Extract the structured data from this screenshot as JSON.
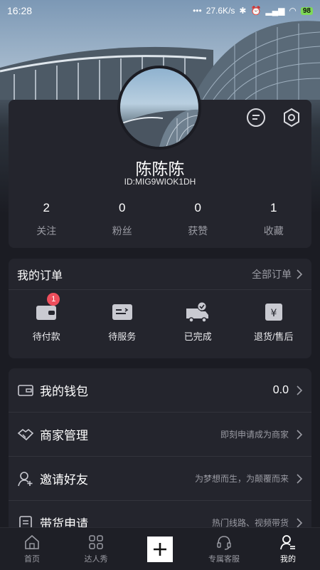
{
  "status_bar": {
    "time": "16:28",
    "network_speed": "27.6K/s",
    "battery": "98"
  },
  "profile": {
    "username": "陈陈陈",
    "user_id": "ID:MIG9WIOK1DH",
    "stats": [
      {
        "value": "2",
        "label": "关注"
      },
      {
        "value": "0",
        "label": "粉丝"
      },
      {
        "value": "0",
        "label": "获赞"
      },
      {
        "value": "1",
        "label": "收藏"
      }
    ]
  },
  "orders": {
    "title": "我的订单",
    "all_orders": "全部订单",
    "items": [
      {
        "label": "待付款",
        "icon": "wallet-icon",
        "badge": "1"
      },
      {
        "label": "待服务",
        "icon": "service-box-icon"
      },
      {
        "label": "已完成",
        "icon": "delivery-truck-icon"
      },
      {
        "label": "退货/售后",
        "icon": "refund-icon"
      }
    ]
  },
  "menu": [
    {
      "label": "我的钱包",
      "value": "0.0",
      "icon": "wallet-card-icon"
    },
    {
      "label": "商家管理",
      "value": "即刻申请成为商家",
      "icon": "handshake-icon"
    },
    {
      "label": "邀请好友",
      "value": "为梦想而生，为颠覆而来",
      "icon": "add-user-icon"
    },
    {
      "label": "带货申请",
      "value": "热门线路、视频带货",
      "icon": "document-icon"
    }
  ],
  "tabs": [
    {
      "label": "首页",
      "icon": "home-icon"
    },
    {
      "label": "达人秀",
      "icon": "grid-icon"
    },
    {
      "label": "",
      "icon": "plus-icon"
    },
    {
      "label": "专属客服",
      "icon": "headset-icon"
    },
    {
      "label": "我的",
      "icon": "profile-icon"
    }
  ],
  "colors": {
    "background": "#1b1c23",
    "card": "#24252d",
    "badge": "#ee4e5c",
    "muted_text": "#9a9ba3"
  }
}
